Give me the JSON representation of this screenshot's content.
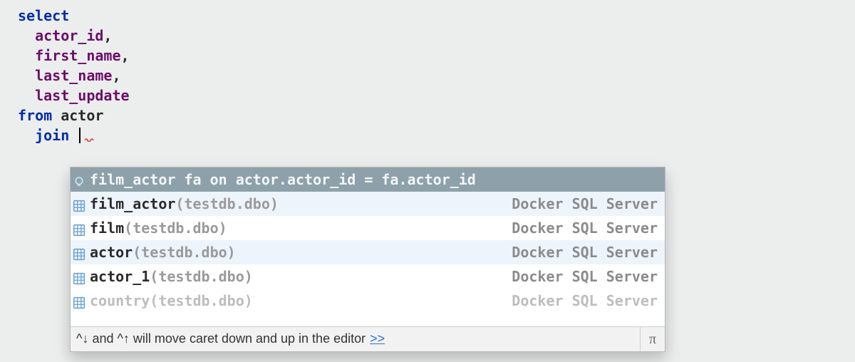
{
  "code": {
    "kw_select": "select",
    "col1": "actor_id",
    "col2": "first_name",
    "col3": "last_name",
    "col4": "last_update",
    "kw_from": "from",
    "table": "actor",
    "kw_join": "join",
    "comma": ","
  },
  "suggestions": [
    {
      "text": "film_actor fa on actor.actor_id = fa.actor_id",
      "context": "",
      "source": "",
      "iconColor": "#bfe4f0",
      "selected": true
    },
    {
      "text": "film_actor",
      "context": " (testdb.dbo)",
      "source": "Docker SQL Server",
      "iconColor": "#6aa3d4"
    },
    {
      "text": "film",
      "context": " (testdb.dbo)",
      "source": "Docker SQL Server",
      "iconColor": "#6aa3d4"
    },
    {
      "text": "actor",
      "context": " (testdb.dbo)",
      "source": "Docker SQL Server",
      "iconColor": "#6aa3d4"
    },
    {
      "text": "actor_1",
      "context": " (testdb.dbo)",
      "source": "Docker SQL Server",
      "iconColor": "#6aa3d4"
    },
    {
      "text": "country",
      "context": " (testdb.dbo)",
      "source": "Docker SQL Server",
      "iconColor": "#6aa3d4"
    }
  ],
  "hint": {
    "text": "^↓ and ^↑ will move caret down and up in the editor",
    "more": ">>",
    "pi": "π"
  }
}
